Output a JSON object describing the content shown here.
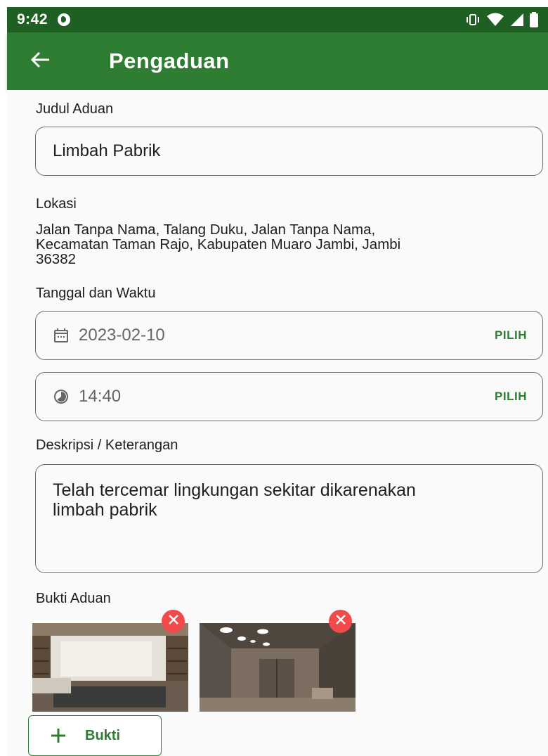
{
  "status_bar": {
    "time": "9:42",
    "icons": [
      "app-notification-icon",
      "vibrate-icon",
      "wifi-icon",
      "signal-icon",
      "battery-icon"
    ]
  },
  "app_bar": {
    "title": "Pengaduan",
    "back_icon": "arrow-left-icon",
    "color": "#2e7d32",
    "status_color": "#1f5f24"
  },
  "form": {
    "judul": {
      "label": "Judul Aduan",
      "value": "Limbah Pabrik"
    },
    "lokasi": {
      "label": "Lokasi",
      "lines": [
        "Jalan Tanpa Nama, Talang Duku, Jalan Tanpa Nama,",
        "Kecamatan Taman Rajo, Kabupaten Muaro Jambi, Jambi",
        "36382"
      ]
    },
    "tanggal_waktu": {
      "label": "Tanggal dan Waktu",
      "date": {
        "icon": "calendar-icon",
        "value": "2023-02-10",
        "action": "PILIH"
      },
      "time": {
        "icon": "clock-icon",
        "value": "14:40",
        "action": "PILIH"
      }
    },
    "deskripsi": {
      "label": "Deskripsi / Keterangan",
      "lines": [
        "Telah tercemar lingkungan sekitar dikarenakan",
        "limbah pabrik"
      ]
    },
    "bukti": {
      "label": "Bukti Aduan",
      "photos": [
        {
          "icon": "room-photo-icon",
          "remove_icon": "close-circle-icon"
        },
        {
          "icon": "interior-photo-icon",
          "remove_icon": "close-circle-icon"
        }
      ],
      "add_button": {
        "icon": "plus-icon",
        "label": "Bukti"
      }
    }
  },
  "colors": {
    "accent": "#2e7d32",
    "danger": "#f24a4a",
    "border": "#6f6f6f"
  }
}
